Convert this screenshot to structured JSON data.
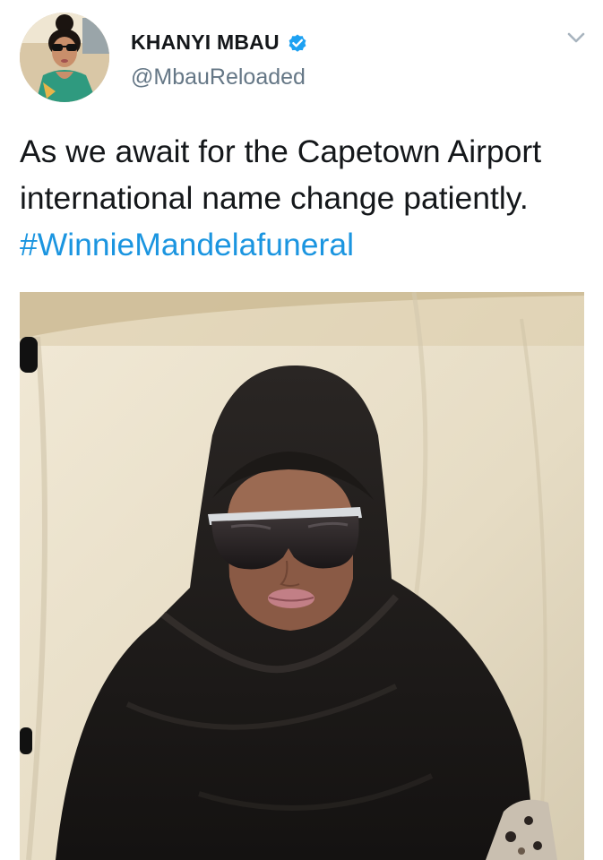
{
  "tweet": {
    "author": {
      "display_name": "KHANYI MBAU",
      "handle": "@MbauReloaded",
      "verified": true
    },
    "text_plain": "As we await for the Capetown Airport international name change patiently.",
    "hashtag": "#WinnieMandelafuneral",
    "media": {
      "description_icon": "photo"
    },
    "colors": {
      "link": "#1b95e0",
      "secondary_text": "#657786",
      "verified_badge": "#1da1f2"
    }
  }
}
